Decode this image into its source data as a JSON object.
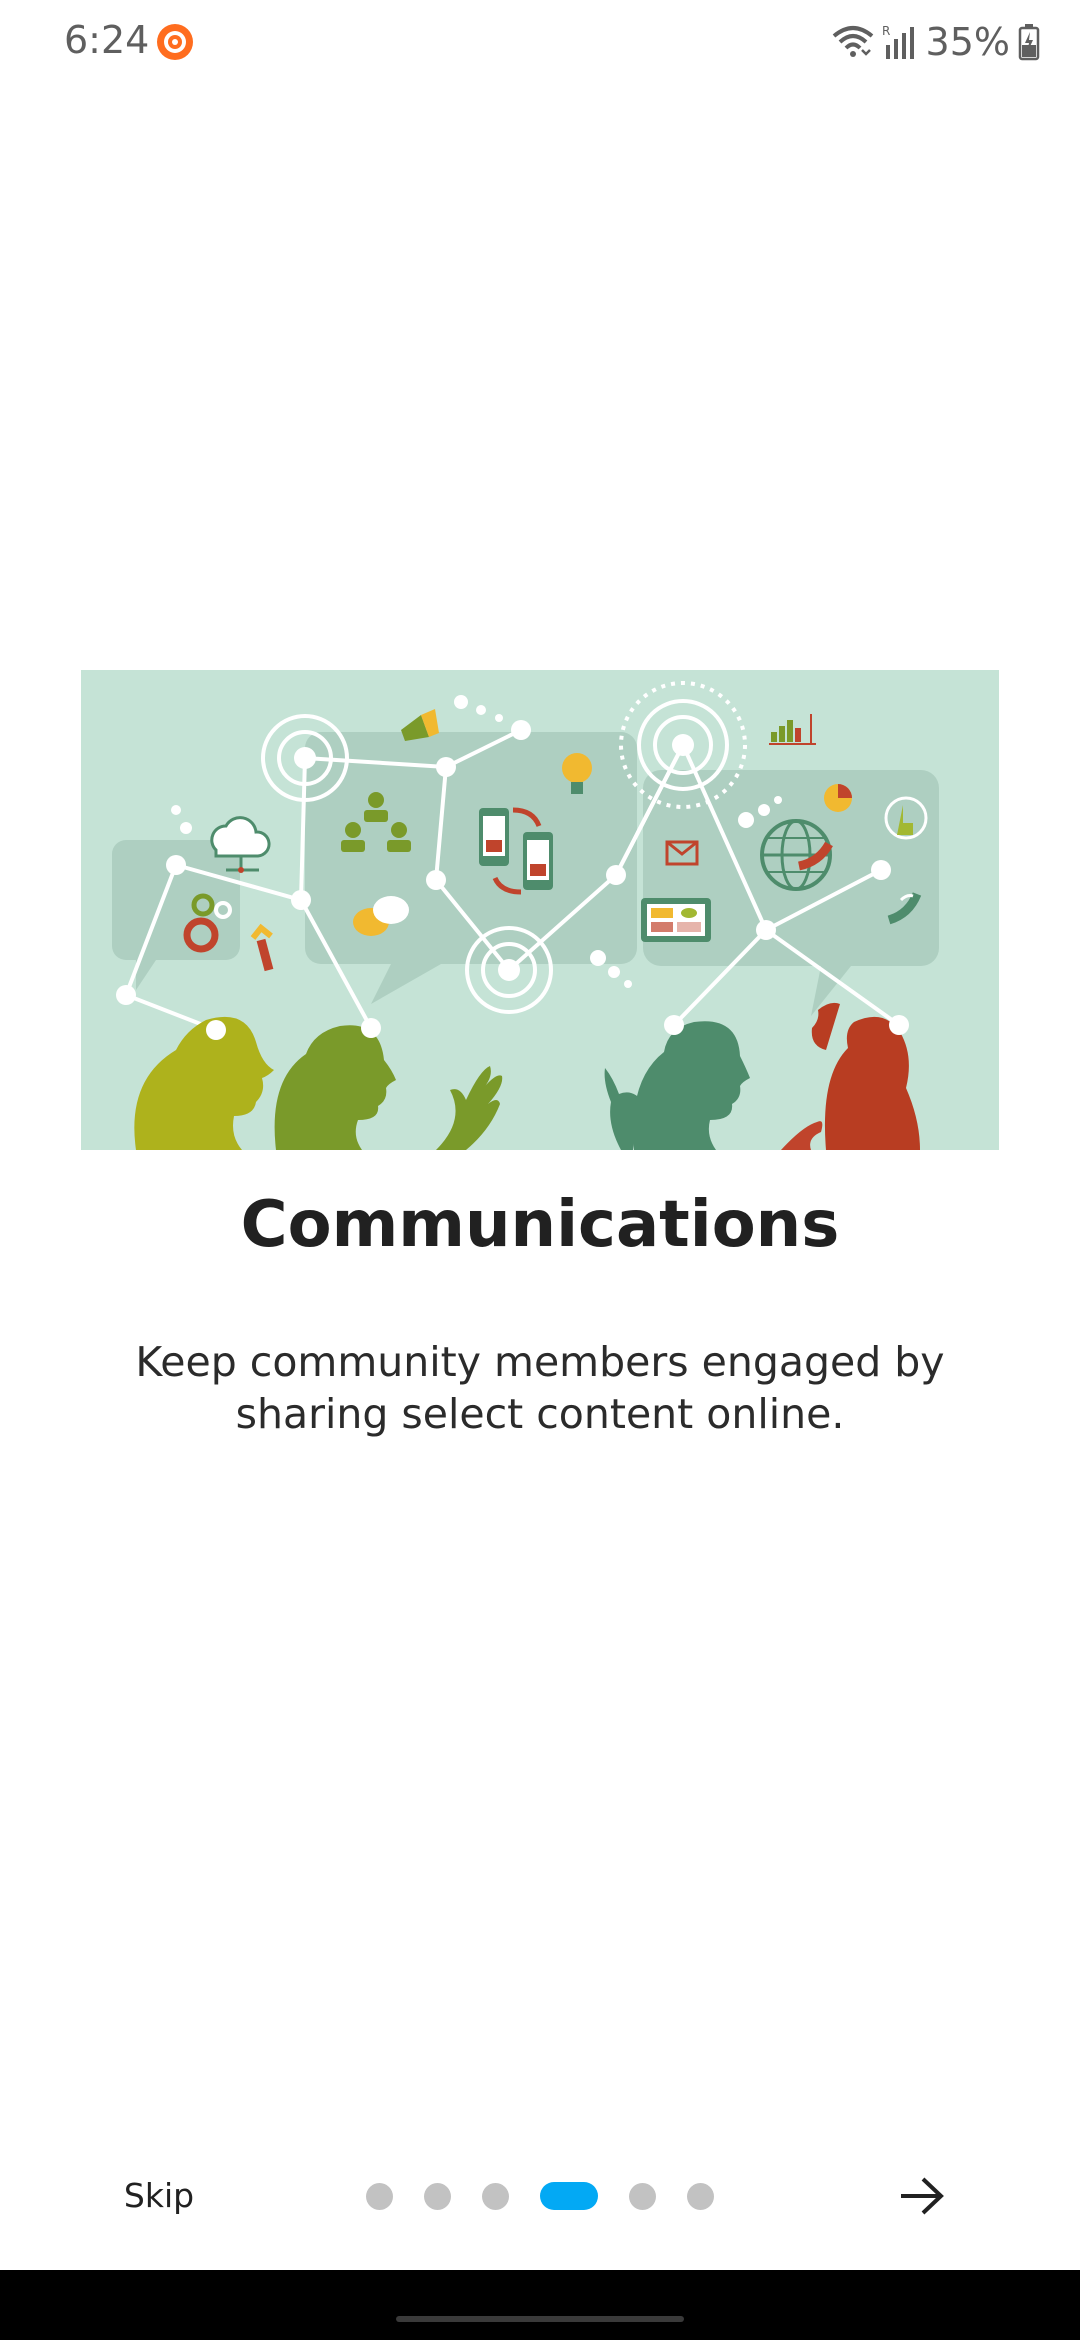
{
  "status_bar": {
    "time": "6:24",
    "battery": "35%",
    "icons": [
      "app-notification-icon",
      "wifi-icon",
      "signal-icon",
      "battery-icon"
    ]
  },
  "slide": {
    "illustration": "communications-network-illustration",
    "title": "Communications",
    "description": "Keep community members engaged by sharing select content online."
  },
  "navigation": {
    "skip_label": "Skip",
    "page_count": 6,
    "current_page": 4,
    "next_icon": "arrow-right-icon",
    "accent_color": "#03a9f4",
    "inactive_dot_color": "#c2c2c2"
  }
}
